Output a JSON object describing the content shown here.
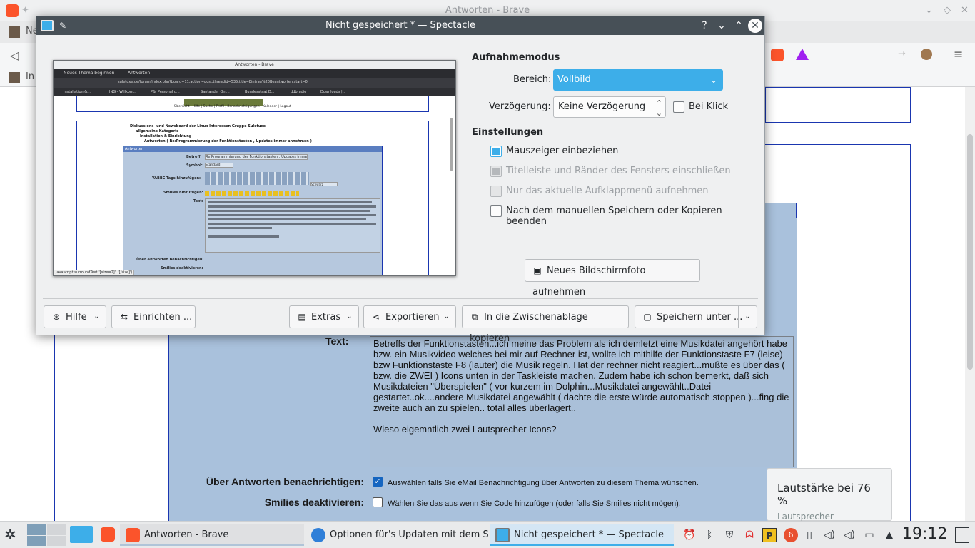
{
  "browser": {
    "window_title": "Antworten - Brave",
    "tab_partial_1": "Ne",
    "bookmark_partial": "In"
  },
  "forum": {
    "text_label": "Text:",
    "message": "Betreffs der Funktionstasten...ich meine das Problem als ich demletzt eine Musikdatei angehört habe bzw. ein Musikvideo welches bei mir auf Rechner ist, wollte ich mithilfe der Funktionstaste F7 (leise) bzw Funktionstaste F8 (lauter) die Musik regeln. Hat der rechner nicht reagiert...mußte es über das ( bzw. die ZWEI ) Icons unten in der Taskleiste machen. Zudem habe ich schon bemerkt, daß sich Musikdateien \"Überspielen\" ( vor kurzem im Dolphin...Musikdatei angewählt..Datei gestartet..ok....andere Musikdatei angewählt ( dachte die erste würde automatisch stoppen )...fing die zweite auch an zu spielen.. total alles überlagert..\n\nWieso eigemntlich zwei Lautsprecher Icons?",
    "notify_label": "Über Antworten benachrichtigen:",
    "notify_note": "Auswählen falls Sie eMail Benachrichtigung über Antworten zu diesem Thema wünschen.",
    "smilies_label": "Smilies deaktivieren:",
    "smilies_note": "Wählen Sie das aus wenn Sie Code hinzufügen (oder falls Sie Smilies nicht mögen)."
  },
  "osd": {
    "title": "Lautstärke bei 76 %",
    "subtitle": "Lautsprecher",
    "volume_percent": 76
  },
  "dialog": {
    "title": "Nicht gespeichert * — Spectacle",
    "capture_mode_heading": "Aufnahmemodus",
    "area_label": "Bereich:",
    "area_value": "Vollbild",
    "delay_label": "Verzögerung:",
    "delay_value": "Keine Verzögerung",
    "on_click_label": "Bei Klick",
    "settings_heading": "Einstellungen",
    "options": [
      {
        "label": "Mauszeiger einbeziehen",
        "checked": true,
        "disabled": false
      },
      {
        "label": "Titelleiste und Ränder des Fensters einschließen",
        "checked": true,
        "disabled": true
      },
      {
        "label": "Nur das aktuelle Aufklappmenü aufnehmen",
        "checked": false,
        "disabled": true
      },
      {
        "label": "Nach dem manuellen Speichern oder Kopieren beenden",
        "checked": false,
        "disabled": false
      }
    ],
    "new_screenshot": "Neues Bildschirmfoto aufnehmen",
    "help": "Hilfe",
    "configure": "Einrichten ...",
    "extras": "Extras",
    "export": "Exportieren",
    "clipboard": "In die Zwischenablage kopieren",
    "save_as": "Speichern unter ..."
  },
  "preview": {
    "window_title": "Antworten - Brave",
    "tab1": "Neues Thema beginnen",
    "tab2": "Antworten",
    "url": "suletuxe.de/forum/index.php?board=11;action=post;threadid=535;title=Eintrag%20Beantworten;start=0",
    "bookmarks": [
      "Installation &...",
      "ING - Willkom...",
      "P&I Personal u...",
      "Santander Onl...",
      "Bundesstaat D...",
      "ddbradio",
      "Downloads |..."
    ],
    "nav_links": [
      "Übersicht",
      "Hilfe",
      "Suche",
      "Profil",
      "Benachrichtigungen",
      "Kalender",
      "Logout"
    ],
    "tree": [
      "Diskussions- und Newsboard der Linux Interessen Gruppe Suletuxe",
      "allgemeine Kategorie",
      "Installation & Einrichtung",
      "Antworten ( Re:Programmierung der Funktionstasten , Updates immer annehmen )"
    ],
    "header": "Antworten",
    "subject_label": "Betreff:",
    "subject_value": "Re:Programmierung der Funktionstasten , Updates imme",
    "symbol_label": "Symbol:",
    "symbol_value": "Standard",
    "yabbc_label": "YABBC Tags hinzufügen:",
    "font_select": "Schwarz",
    "smilies_label": "Smilies hinzufügen:",
    "text_label": "Text:",
    "notify_label": "Über Antworten benachrichtigen:",
    "smilies_off_label": "Smilies deaktivieren:",
    "status": "javascript:surroundText('[size=2]', '[/size]')"
  },
  "taskbar": {
    "tasks": [
      "Antworten - Brave",
      "Optionen für's Updaten mit dem S...",
      "Nicht gespeichert * — Spectacle"
    ],
    "clock": "19:12",
    "badge": "6"
  }
}
